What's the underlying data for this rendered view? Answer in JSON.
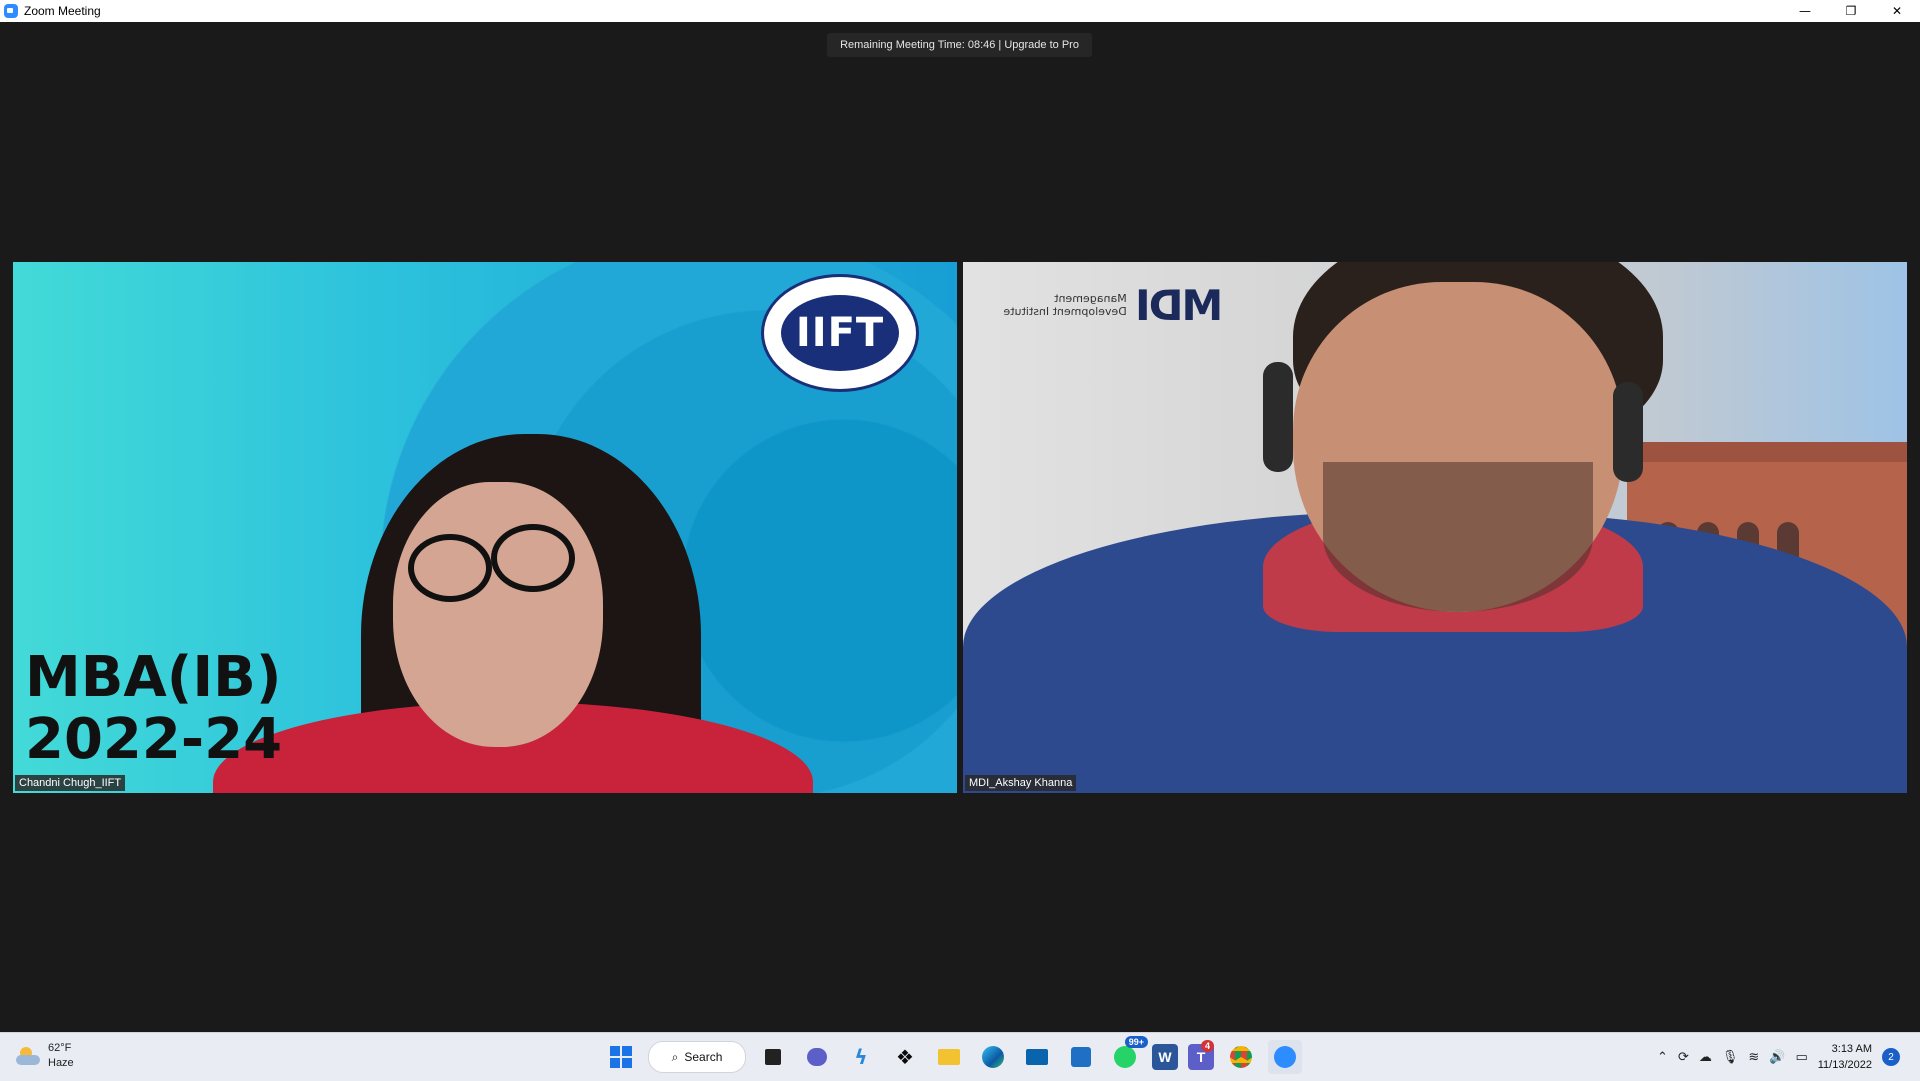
{
  "window": {
    "title": "Zoom Meeting",
    "minimize": "—",
    "restore": "❐",
    "close": "✕"
  },
  "banner": {
    "text": "Remaining Meeting Time: 08:46 | Upgrade to Pro"
  },
  "participants": [
    {
      "name": "Chandni Chugh_IIFT",
      "background_text_line1": "MBA(IB)",
      "background_text_line2": "2022-24",
      "logo_text": "IIFT"
    },
    {
      "name": "MDI_Akshay Khanna",
      "logo_text": "MDI",
      "logo_small": "Management Development Institute"
    }
  ],
  "taskbar": {
    "weather": {
      "temp": "62°F",
      "condition": "Haze"
    },
    "search_label": "Search",
    "apps": [
      {
        "name": "start",
        "icon": "windows-icon"
      },
      {
        "name": "search",
        "icon": "search-icon"
      },
      {
        "name": "task-view",
        "icon": "task-view-icon"
      },
      {
        "name": "chat",
        "icon": "chat-icon",
        "color": "#5b5fc7"
      },
      {
        "name": "app",
        "icon": "bolt-icon",
        "color": "#2b88d8"
      },
      {
        "name": "dropbox",
        "icon": "dropbox-icon",
        "color": "#0061fe"
      },
      {
        "name": "file-explorer",
        "icon": "folder-icon",
        "color": "#f2c230"
      },
      {
        "name": "edge",
        "icon": "edge-icon",
        "color": "#0c8bd0"
      },
      {
        "name": "mail",
        "icon": "mail-icon",
        "color": "#0a64ad"
      },
      {
        "name": "store",
        "icon": "store-icon",
        "color": "#1f6fc5"
      },
      {
        "name": "whatsapp",
        "icon": "chat-badge-icon",
        "badge": "99+"
      },
      {
        "name": "word",
        "icon": "word-icon",
        "label": "W",
        "color": "#2b579a"
      },
      {
        "name": "teams",
        "icon": "teams-icon",
        "label": "T",
        "color": "#5b5fc7",
        "badge": "4"
      },
      {
        "name": "chrome",
        "icon": "chrome-icon"
      },
      {
        "name": "zoom",
        "icon": "zoom-icon",
        "color": "#2d8cff"
      }
    ],
    "time": "3:13 AM",
    "date": "11/13/2022",
    "notifications": "2"
  }
}
